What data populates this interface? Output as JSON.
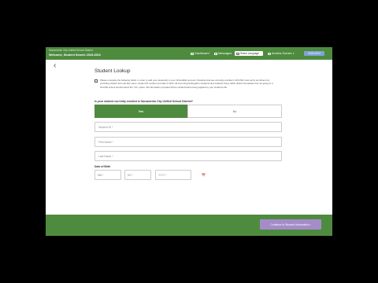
{
  "header": {
    "subtitle": "Sacramento City Unified School District",
    "title": "Welcome, Student Search 2023-2024",
    "links": [
      {
        "label": "Dashboard",
        "icon": "dashboard-icon"
      },
      {
        "label": "Messages",
        "icon": "message-icon"
      }
    ],
    "language": "Select Language",
    "account": "Andrea Gomez",
    "year": "2023-2024"
  },
  "page": {
    "back": "‹",
    "title": "Student Lookup",
    "intro": "Please complete the following fields, in order to add your student(s) to your SchoolMint account. Students that are currently enrolled in SCUSD must verify enrollment by providing student first and last name, student ID number and date of birth. All incoming kindergarten students and students living within district boundaries but not going to a SCUSD school should select the \"No\" option. All information provided will be verified before being applied to your student's file.",
    "question": "Is your student currently enrolled in Sacramento City Unified School District?",
    "yes": "Yes",
    "no": "No",
    "student_id_placeholder": "Student ID *",
    "first_name_placeholder": "First Name *",
    "last_name_placeholder": "Last Name *",
    "dob_label": "Date of Birth",
    "mm": "MM *",
    "dd": "DD *",
    "yyyy": "YYYY *",
    "calendar": "📅"
  },
  "footer": {
    "continue": "Continue to Student Information ›"
  },
  "colors": {
    "brand_green": "#4e8b3f",
    "continue_purple": "#a58cc9",
    "year_blue": "#7fa3d6"
  }
}
